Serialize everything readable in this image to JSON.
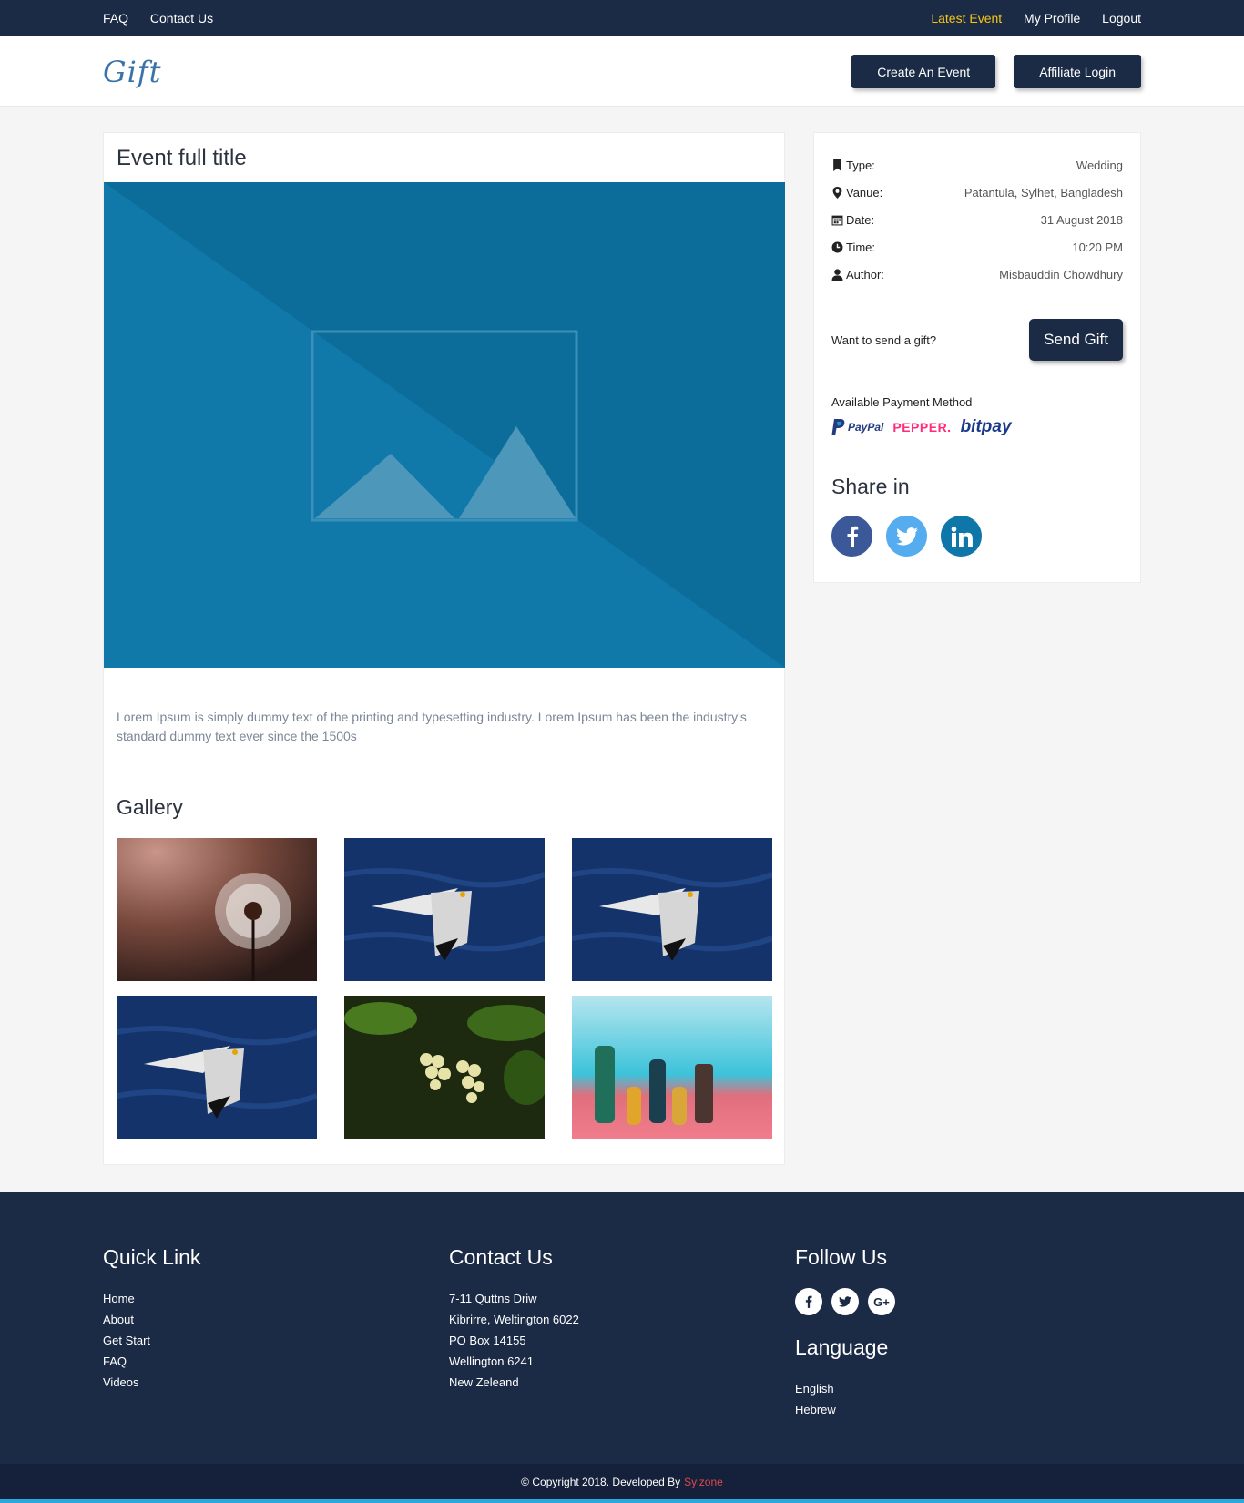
{
  "topbar": {
    "left_links": [
      "FAQ",
      "Contact Us"
    ],
    "right_links": [
      {
        "label": "Latest Event",
        "active": true
      },
      {
        "label": "My Profile",
        "active": false
      },
      {
        "label": "Logout",
        "active": false
      }
    ]
  },
  "header": {
    "logo": "Gift",
    "create_event": "Create An Event",
    "affiliate_login": "Affiliate Login"
  },
  "event": {
    "title": "Event full title",
    "description": "Lorem Ipsum is simply dummy text of the printing and typesetting industry. Lorem Ipsum has been the industry's standard dummy text ever since the 1500s",
    "gallery_title": "Gallery",
    "gallery": [
      "dandelion",
      "seagull",
      "seagull",
      "seagull",
      "grapes",
      "chess-pieces"
    ]
  },
  "sidebar": {
    "info": [
      {
        "icon": "bookmark-icon",
        "key": "Type:",
        "value": "Wedding"
      },
      {
        "icon": "map-marker-icon",
        "key": "Vanue:",
        "value": "Patantula, Sylhet, Bangladesh"
      },
      {
        "icon": "calendar-icon",
        "key": "Date:",
        "value": "31 August 2018"
      },
      {
        "icon": "clock-icon",
        "key": "Time:",
        "value": "10:20 PM"
      },
      {
        "icon": "user-icon",
        "key": "Author:",
        "value": "Misbauddin Chowdhury"
      }
    ],
    "gift_prompt": "Want to send a gift?",
    "send_gift": "Send Gift",
    "payment_title": "Available Payment Method",
    "payment_methods": {
      "paypal": "PayPal",
      "pepper": "PEPPER.",
      "bitpay": "bitpay"
    },
    "share_title": "Share in"
  },
  "footer": {
    "quick_link_title": "Quick Link",
    "quick_links": [
      "Home",
      "About",
      "Get Start",
      "FAQ",
      "Videos"
    ],
    "contact_title": "Contact Us",
    "contact_lines": [
      "7-11 Quttns Driw",
      "Kibrirre, Weltington 6022",
      "PO Box 14155",
      "Wellington 6241",
      "New Zeleand"
    ],
    "follow_title": "Follow Us",
    "language_title": "Language",
    "languages": [
      "English",
      "Hebrew"
    ],
    "copyright": "© Copyright 2018. Developed By",
    "developer": "Sylzone"
  },
  "colors": {
    "navy": "#1b2a45",
    "accent_yellow": "#f5c518",
    "hero_blue": "#0f76a6",
    "facebook": "#3b5998",
    "twitter": "#55acee",
    "linkedin": "#0e76a8"
  }
}
